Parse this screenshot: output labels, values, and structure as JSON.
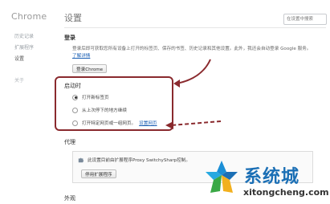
{
  "sidebar": {
    "brand": "Chrome",
    "items": [
      {
        "label": "历史记录"
      },
      {
        "label": "扩展程序"
      },
      {
        "label": "设置"
      },
      {
        "label": "关于"
      }
    ]
  },
  "header": {
    "title": "设置",
    "search_placeholder": "在设置中搜索"
  },
  "signin": {
    "heading": "登录",
    "description": "登录后即可获取您所有设备上打开的标签页、保存的书签、历史记录和其他设置。此外，我还会自动登录 Google 服务。",
    "learn_more": "了解详情",
    "button": "登录Chrome"
  },
  "startup": {
    "heading": "启动时",
    "options": [
      {
        "label": "打开新标签页",
        "checked": true
      },
      {
        "label": "从上次停下的地方继续",
        "checked": false
      },
      {
        "label": "打开特定网页或一组网页。",
        "checked": false
      }
    ],
    "set_pages_link": "设置网页"
  },
  "proxy": {
    "heading": "代理",
    "message": "此设置目前由扩展程序Proxy SwitchySharp控制。",
    "button": "停用扩展程序"
  },
  "appearance": {
    "heading": "外观"
  },
  "watermark": {
    "cn": "系统城",
    "en": "xitongcheng.com"
  },
  "colors": {
    "annotation": "#8a2a2e",
    "link": "#1a5fb4",
    "watermark_blue": "#1b6fb5"
  }
}
